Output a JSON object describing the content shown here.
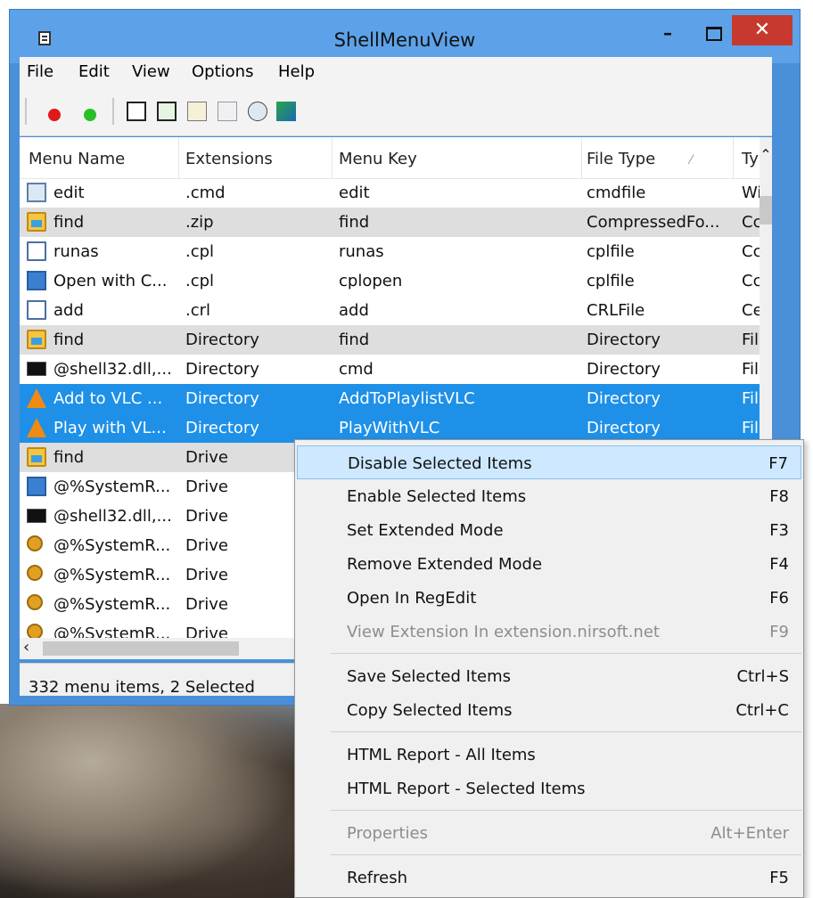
{
  "window": {
    "title": "ShellMenuView",
    "minimize": "–",
    "close": "✕"
  },
  "menubar": [
    "File",
    "Edit",
    "View",
    "Options",
    "Help"
  ],
  "toolbar": {
    "icons": [
      "red-dot-icon",
      "green-dot-icon",
      "save-icon",
      "refresh-icon",
      "copy-icon",
      "properties-icon",
      "find-icon",
      "exit-icon"
    ]
  },
  "columns": [
    "Menu Name",
    "Extensions",
    "Menu Key",
    "File Type",
    "Ty"
  ],
  "rows": [
    {
      "icon": "bat-icon",
      "name": "edit",
      "ext": ".cmd",
      "key": "edit",
      "ftype": "cmdfile",
      "ty": "Wi",
      "state": "normal"
    },
    {
      "icon": "folder-icon",
      "name": "find",
      "ext": ".zip",
      "key": "find",
      "ftype": "CompressedFo...",
      "ty": "Cc",
      "state": "alt"
    },
    {
      "icon": "doc-icon",
      "name": "runas",
      "ext": ".cpl",
      "key": "runas",
      "ftype": "cplfile",
      "ty": "Cc",
      "state": "normal"
    },
    {
      "icon": "control-panel-icon",
      "name": "Open with C...",
      "ext": ".cpl",
      "key": "cplopen",
      "ftype": "cplfile",
      "ty": "Cc",
      "state": "normal"
    },
    {
      "icon": "doc-icon",
      "name": "add",
      "ext": ".crl",
      "key": "add",
      "ftype": "CRLFile",
      "ty": "Ce",
      "state": "normal"
    },
    {
      "icon": "folder-icon",
      "name": "find",
      "ext": "Directory",
      "key": "find",
      "ftype": "Directory",
      "ty": "Fil",
      "state": "alt"
    },
    {
      "icon": "cmd-icon",
      "name": "@shell32.dll,...",
      "ext": "Directory",
      "key": "cmd",
      "ftype": "Directory",
      "ty": "Fil",
      "state": "normal"
    },
    {
      "icon": "vlc-icon",
      "name": "Add to VLC ...",
      "ext": "Directory",
      "key": "AddToPlaylistVLC",
      "ftype": "Directory",
      "ty": "Fil",
      "state": "sel"
    },
    {
      "icon": "vlc-icon",
      "name": "Play with VL...",
      "ext": "Directory",
      "key": "PlayWithVLC",
      "ftype": "Directory",
      "ty": "Fil",
      "state": "sel"
    },
    {
      "icon": "folder-icon",
      "name": "find",
      "ext": "Drive",
      "key": "",
      "ftype": "",
      "ty": "",
      "state": "alt"
    },
    {
      "icon": "control-panel-icon",
      "name": "@%SystemR...",
      "ext": "Drive",
      "key": "",
      "ftype": "",
      "ty": "",
      "state": "normal"
    },
    {
      "icon": "cmd-icon",
      "name": "@shell32.dll,...",
      "ext": "Drive",
      "key": "",
      "ftype": "",
      "ty": "",
      "state": "normal"
    },
    {
      "icon": "key-icon",
      "name": "@%SystemR...",
      "ext": "Drive",
      "key": "",
      "ftype": "",
      "ty": "",
      "state": "normal"
    },
    {
      "icon": "key-icon",
      "name": "@%SystemR...",
      "ext": "Drive",
      "key": "",
      "ftype": "",
      "ty": "",
      "state": "normal"
    },
    {
      "icon": "key-icon",
      "name": "@%SystemR...",
      "ext": "Drive",
      "key": "",
      "ftype": "",
      "ty": "",
      "state": "normal"
    },
    {
      "icon": "key-icon",
      "name": "@%SystemR...",
      "ext": "Drive",
      "key": "",
      "ftype": "",
      "ty": "",
      "state": "normal"
    }
  ],
  "status": "332 menu items, 2 Selected",
  "context_menu": [
    {
      "label": "Disable Selected Items",
      "key": "F7",
      "state": "hover"
    },
    {
      "label": "Enable Selected Items",
      "key": "F8",
      "state": "normal"
    },
    {
      "label": "Set Extended Mode",
      "key": "F3",
      "state": "normal"
    },
    {
      "label": "Remove Extended Mode",
      "key": "F4",
      "state": "normal"
    },
    {
      "label": "Open In RegEdit",
      "key": "F6",
      "state": "normal"
    },
    {
      "label": "View Extension In extension.nirsoft.net",
      "key": "F9",
      "state": "disabled"
    },
    {
      "label": "Save Selected Items",
      "key": "Ctrl+S",
      "state": "normal"
    },
    {
      "label": "Copy Selected Items",
      "key": "Ctrl+C",
      "state": "normal"
    },
    {
      "label": "HTML Report - All Items",
      "key": "",
      "state": "normal"
    },
    {
      "label": "HTML Report - Selected Items",
      "key": "",
      "state": "normal"
    },
    {
      "label": "Properties",
      "key": "Alt+Enter",
      "state": "disabled"
    },
    {
      "label": "Refresh",
      "key": "F5",
      "state": "normal"
    }
  ],
  "colors": {
    "selection": "#1e90e8",
    "menu_hover": "#cde8ff",
    "close_button": "#c7392f",
    "titlebar": "#5da2e8"
  }
}
